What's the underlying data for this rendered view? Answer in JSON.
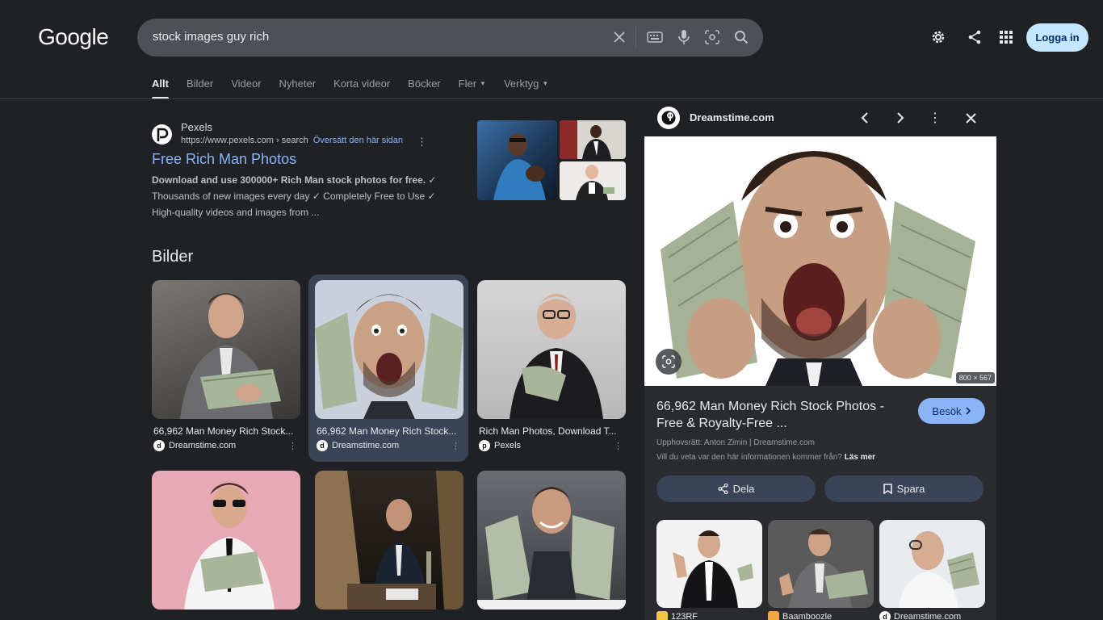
{
  "header": {
    "logo": "Google",
    "query": "stock images guy rich",
    "login": "Logga in",
    "icons": [
      "clear-icon",
      "keyboard-icon",
      "mic-icon",
      "lens-icon",
      "search-icon",
      "settings-icon",
      "share-icon",
      "apps-icon"
    ]
  },
  "tabs": [
    {
      "label": "Allt",
      "active": true
    },
    {
      "label": "Bilder"
    },
    {
      "label": "Videor"
    },
    {
      "label": "Nyheter"
    },
    {
      "label": "Korta videor"
    },
    {
      "label": "Böcker"
    },
    {
      "label": "Fler"
    },
    {
      "label": "Verktyg"
    }
  ],
  "result": {
    "site": "Pexels",
    "url": "https://www.pexels.com › search",
    "translate": "Översätt den här sidan",
    "title": "Free Rich Man Photos",
    "snippet_bold": "Download and use 300000+ Rich Man stock photos for free.",
    "snippet_rest": " ✓ Thousands of new images every day ✓ Completely Free to Use ✓ High-quality videos and images from ..."
  },
  "images_heading": "Bilder",
  "images": [
    {
      "caption": "66,962 Man Money Rich Stock...",
      "source": "Dreamstime.com"
    },
    {
      "caption": "66,962 Man Money Rich Stock...",
      "source": "Dreamstime.com"
    },
    {
      "caption": "Rich Man Photos, Download T...",
      "source": "Pexels"
    },
    {
      "caption": "",
      "source": ""
    },
    {
      "caption": "",
      "source": ""
    },
    {
      "caption": "",
      "source": ""
    }
  ],
  "panel": {
    "site": "Dreamstime.com",
    "dimensions": "800 × 567",
    "title": "66,962 Man Money Rich Stock Photos - Free & Royalty-Free ...",
    "visit": "Besök",
    "copyright": "Upphovsrätt: Anton Zimin | Dreamstime.com",
    "info": "Vill du veta var den här informationen kommer från?",
    "info_link": "Läs mer",
    "share": "Dela",
    "save": "Spara",
    "related": [
      {
        "source": "123RF"
      },
      {
        "source": "Baamboozle"
      },
      {
        "source": "Dreamstime.com"
      }
    ]
  }
}
